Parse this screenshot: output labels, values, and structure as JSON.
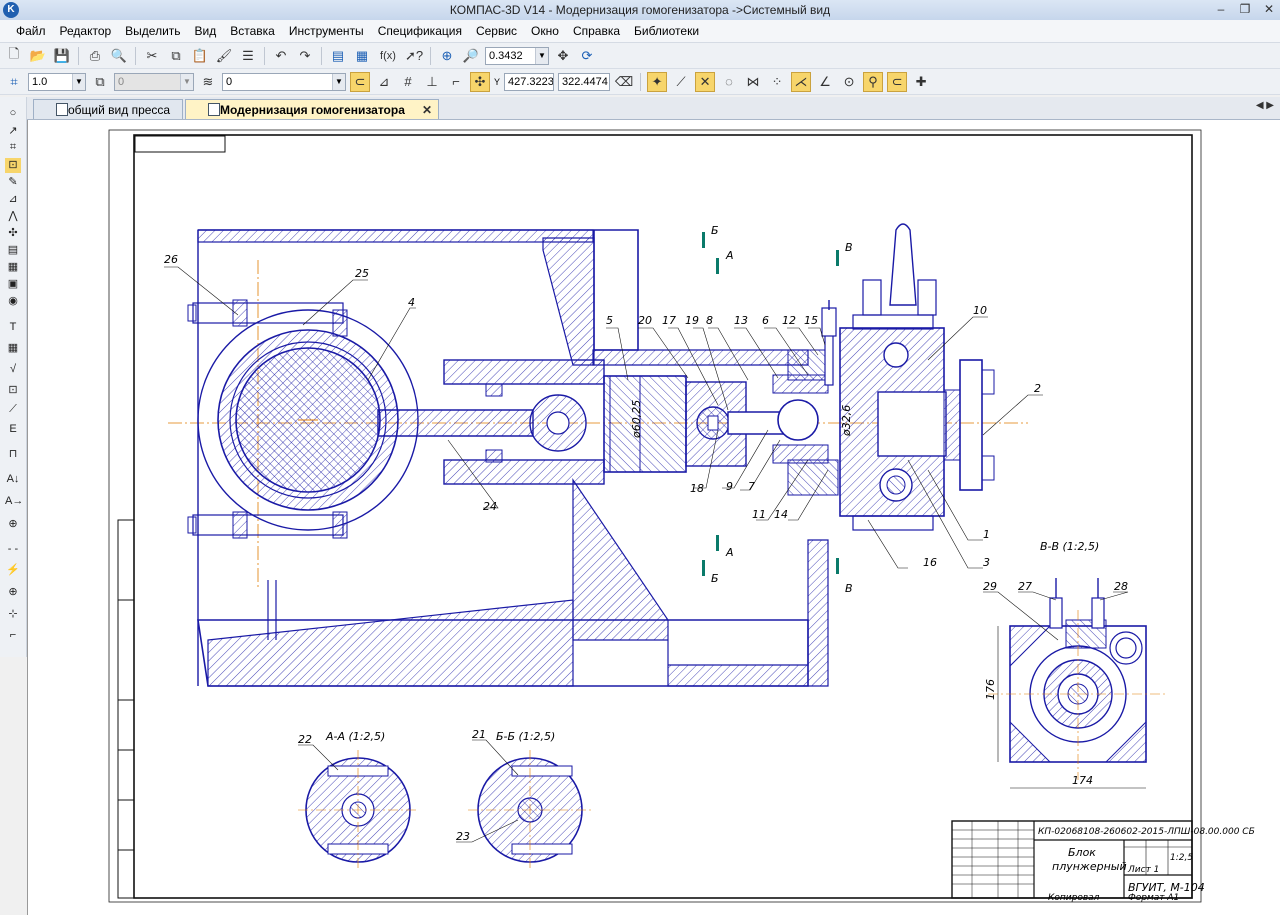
{
  "window": {
    "title": "КОМПАС-3D V14 - Модернизация гомогенизатора ->Системный вид"
  },
  "menu": [
    "Файл",
    "Редактор",
    "Выделить",
    "Вид",
    "Вставка",
    "Инструменты",
    "Спецификация",
    "Сервис",
    "Окно",
    "Справка",
    "Библиотеки"
  ],
  "toolbar": {
    "zoom_value": "0.3432",
    "fx_label": "f(x)"
  },
  "toolbar2": {
    "line_scale": "1.0",
    "layer_state": "0",
    "layer_number": "0",
    "coord_x": "427.3223",
    "coord_y": "322.4474"
  },
  "tabs": [
    {
      "label": "общий вид пресса",
      "active": false
    },
    {
      "label": "Модернизация гомогенизатора",
      "active": true
    }
  ],
  "drawing": {
    "part_numbers": [
      "26",
      "25",
      "4",
      "5",
      "20",
      "17",
      "19",
      "8",
      "13",
      "6",
      "12",
      "15",
      "10",
      "2",
      "1",
      "3",
      "16",
      "14",
      "11",
      "7",
      "9",
      "18",
      "24",
      "29",
      "27",
      "28",
      "22",
      "21",
      "23"
    ],
    "section_labels": {
      "bv": "В-В (1:2,5)",
      "aa": "А-А (1:2,5)",
      "bb": "Б-Б (1:2,5)"
    },
    "markers": {
      "b": "Б",
      "a": "А",
      "v": "В"
    },
    "dims": {
      "d1": "ø60,25",
      "d2": "ø32,6",
      "d3": "176",
      "d4": "174"
    },
    "title_block": {
      "doc_code": "КП-02068108-260602-2015-ЛПШ-08.00.000 СБ",
      "name_line1": "Блок",
      "name_line2": "плунжерный",
      "scale": "1:2,5",
      "org": "ВГУИТ, М-104",
      "sheets": "Лист 1",
      "copied": "Копировал",
      "format": "Формат А1"
    }
  },
  "colors": {
    "line": "#1a1aa6",
    "axis": "#e07b00",
    "frame": "#000000"
  }
}
